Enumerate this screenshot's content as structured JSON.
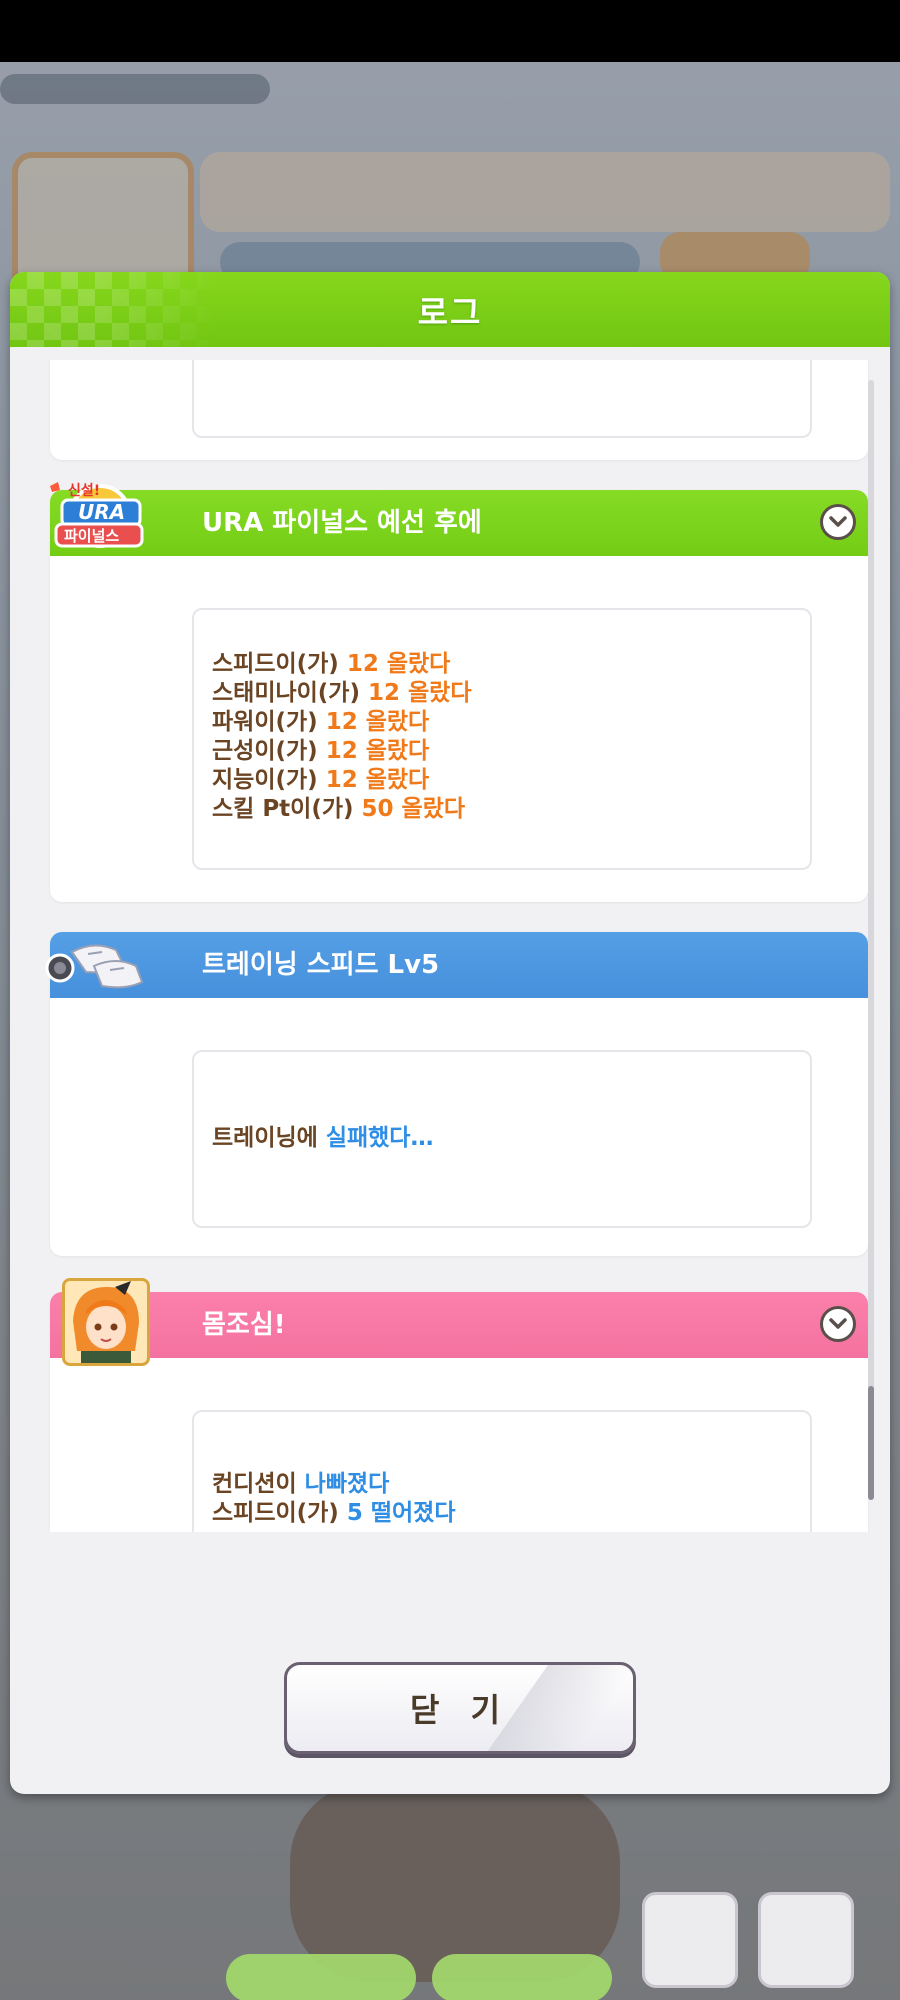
{
  "modal": {
    "title": "로그",
    "close_label": "닫 기"
  },
  "colors": {
    "header_green": "#7ccf16",
    "event_green": "#7fd41f",
    "training_blue": "#4a96e0",
    "condition_pink": "#f57aa5",
    "text_brown": "#6b4423",
    "gain_orange": "#f07a1a",
    "info_blue": "#2e8ee6"
  },
  "entries": [
    {
      "title": "URA 파이널스 예선 후에",
      "icon": "ura-finals-icon",
      "icon_text": [
        "신설!",
        "URA",
        "파이널스"
      ],
      "expandable": true,
      "lines": [
        {
          "label": "스피드이(가)",
          "value": "12 올랐다"
        },
        {
          "label": "스태미나이(가)",
          "value": "12 올랐다"
        },
        {
          "label": "파워이(가)",
          "value": "12 올랐다"
        },
        {
          "label": "근성이(가)",
          "value": "12 올랐다"
        },
        {
          "label": "지능이(가)",
          "value": "12 올랐다"
        },
        {
          "label": "스킬 Pt이(가)",
          "value": "50 올랐다"
        }
      ]
    },
    {
      "title": "트레이닝 스피드 Lv5",
      "icon": "training-shoes-icon",
      "expandable": false,
      "lines": [
        {
          "label": "트레이닝에",
          "value": "실패했다…"
        }
      ]
    },
    {
      "title": "몸조심!",
      "icon": "character-avatar",
      "expandable": true,
      "lines": [
        {
          "label": "컨디션이",
          "value": "나빠졌다"
        },
        {
          "label": "스피드이(가)",
          "value": "5 떨어졌다"
        }
      ]
    }
  ]
}
